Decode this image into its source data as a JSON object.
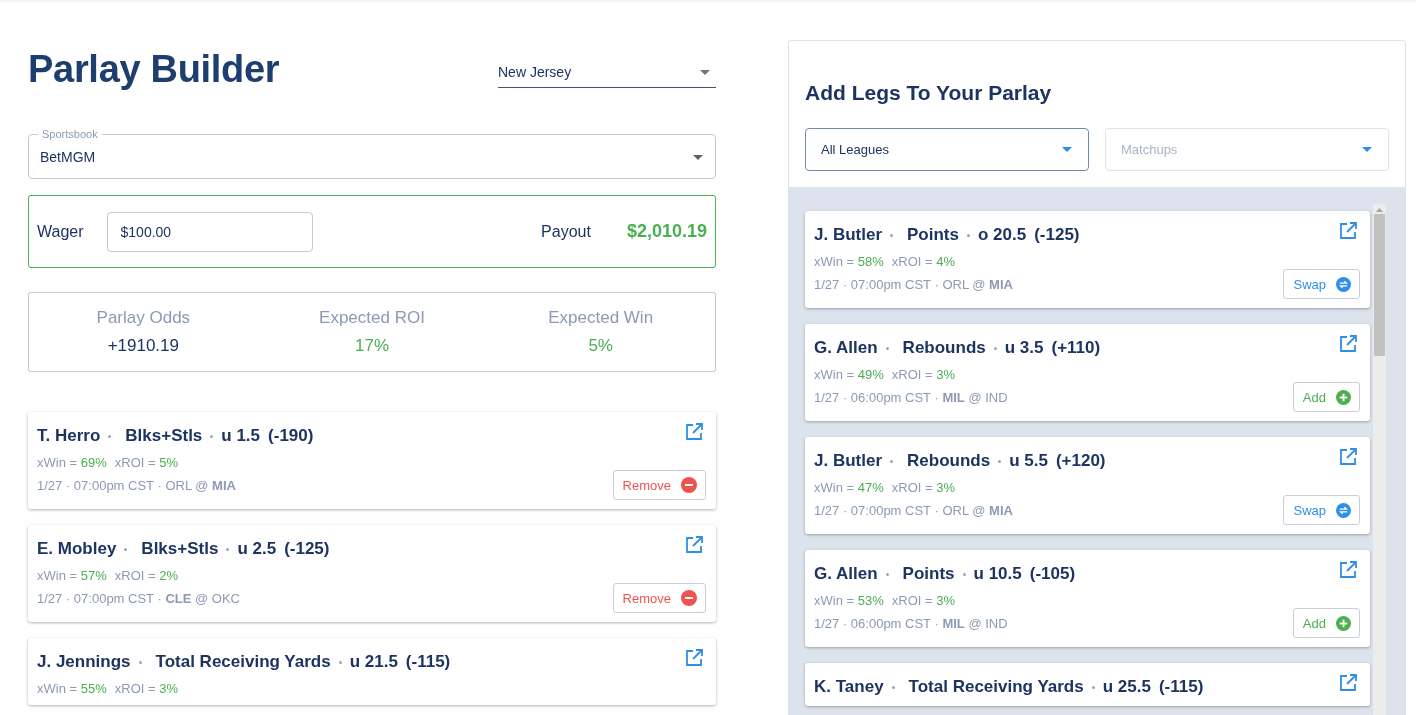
{
  "title": "Parlay Builder",
  "state_select": {
    "value": "New Jersey"
  },
  "sportsbook": {
    "label": "Sportsbook",
    "value": "BetMGM"
  },
  "wager": {
    "label": "Wager",
    "value": "$100.00",
    "payout_label": "Payout",
    "payout": "$2,010.19"
  },
  "stats": [
    {
      "label": "Parlay Odds",
      "value": "+1910.19",
      "kind": "neutral"
    },
    {
      "label": "Expected ROI",
      "value": "17%",
      "kind": "positive"
    },
    {
      "label": "Expected Win",
      "value": "5%",
      "kind": "positive"
    }
  ],
  "legs": [
    {
      "player": "T. Herro",
      "market": "Blks+Stls",
      "line": "u 1.5",
      "odds": "(-190)",
      "xwin_label": "xWin =",
      "xwin": "69%",
      "xroi_label": "xROI =",
      "xroi": "5%",
      "game": "1/27 · 07:00pm CST · ORL @ **MIA**",
      "action": {
        "kind": "remove",
        "label": "Remove"
      }
    },
    {
      "player": "E. Mobley",
      "market": "Blks+Stls",
      "line": "u 2.5",
      "odds": "(-125)",
      "xwin_label": "xWin =",
      "xwin": "57%",
      "xroi_label": "xROI =",
      "xroi": "2%",
      "game": "1/27 · 07:00pm CST · **CLE** @ OKC",
      "action": {
        "kind": "remove",
        "label": "Remove"
      }
    },
    {
      "player": "J. Jennings",
      "market": "Total Receiving Yards",
      "line": "u 21.5",
      "odds": "(-115)",
      "xwin_label": "xWin =",
      "xwin": "55%",
      "xroi_label": "xROI =",
      "xroi": "3%"
    }
  ],
  "add_panel": {
    "title": "Add Legs To Your Parlay",
    "league_select": {
      "value": "All Leagues"
    },
    "matchup_select": {
      "placeholder": "Matchups"
    },
    "legs": [
      {
        "player": "J. Butler",
        "market": "Points",
        "line": "o 20.5",
        "odds": "(-125)",
        "xwin_label": "xWin =",
        "xwin": "58%",
        "xroi_label": "xROI =",
        "xroi": "4%",
        "game": "1/27 · 07:00pm CST · ORL @ **MIA**",
        "action": {
          "kind": "swap",
          "label": "Swap"
        }
      },
      {
        "player": "G. Allen",
        "market": "Rebounds",
        "line": "u 3.5",
        "odds": "(+110)",
        "xwin_label": "xWin =",
        "xwin": "49%",
        "xroi_label": "xROI =",
        "xroi": "3%",
        "game": "1/27 · 06:00pm CST · **MIL** @ IND",
        "action": {
          "kind": "add",
          "label": "Add"
        }
      },
      {
        "player": "J. Butler",
        "market": "Rebounds",
        "line": "u 5.5",
        "odds": "(+120)",
        "xwin_label": "xWin =",
        "xwin": "47%",
        "xroi_label": "xROI =",
        "xroi": "3%",
        "game": "1/27 · 07:00pm CST · ORL @ **MIA**",
        "action": {
          "kind": "swap",
          "label": "Swap"
        }
      },
      {
        "player": "G. Allen",
        "market": "Points",
        "line": "u 10.5",
        "odds": "(-105)",
        "xwin_label": "xWin =",
        "xwin": "53%",
        "xroi_label": "xROI =",
        "xroi": "3%",
        "game": "1/27 · 06:00pm CST · **MIL** @ IND",
        "action": {
          "kind": "add",
          "label": "Add"
        }
      },
      {
        "player": "K. Taney",
        "market": "Total Receiving Yards",
        "line": "u 25.5",
        "odds": "(-115)"
      }
    ]
  }
}
